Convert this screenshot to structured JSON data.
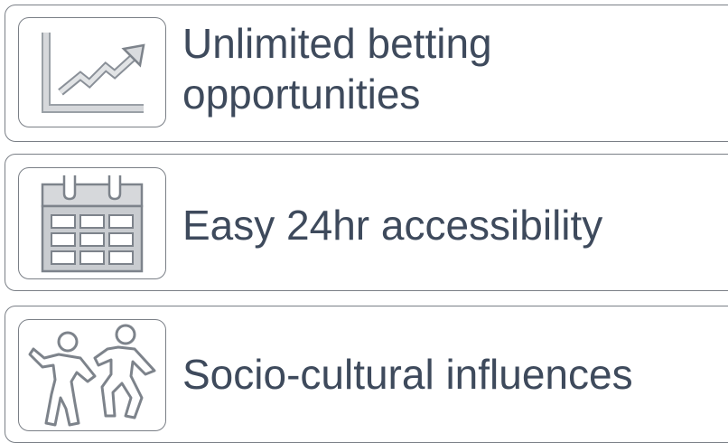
{
  "items": [
    {
      "label_line1": "Unlimited betting",
      "label_line2": "opportunities",
      "icon": "line-chart-icon"
    },
    {
      "label": "Easy 24hr accessibility",
      "icon": "calendar-icon"
    },
    {
      "label": "Socio-cultural influences",
      "icon": "dancing-people-icon"
    }
  ]
}
